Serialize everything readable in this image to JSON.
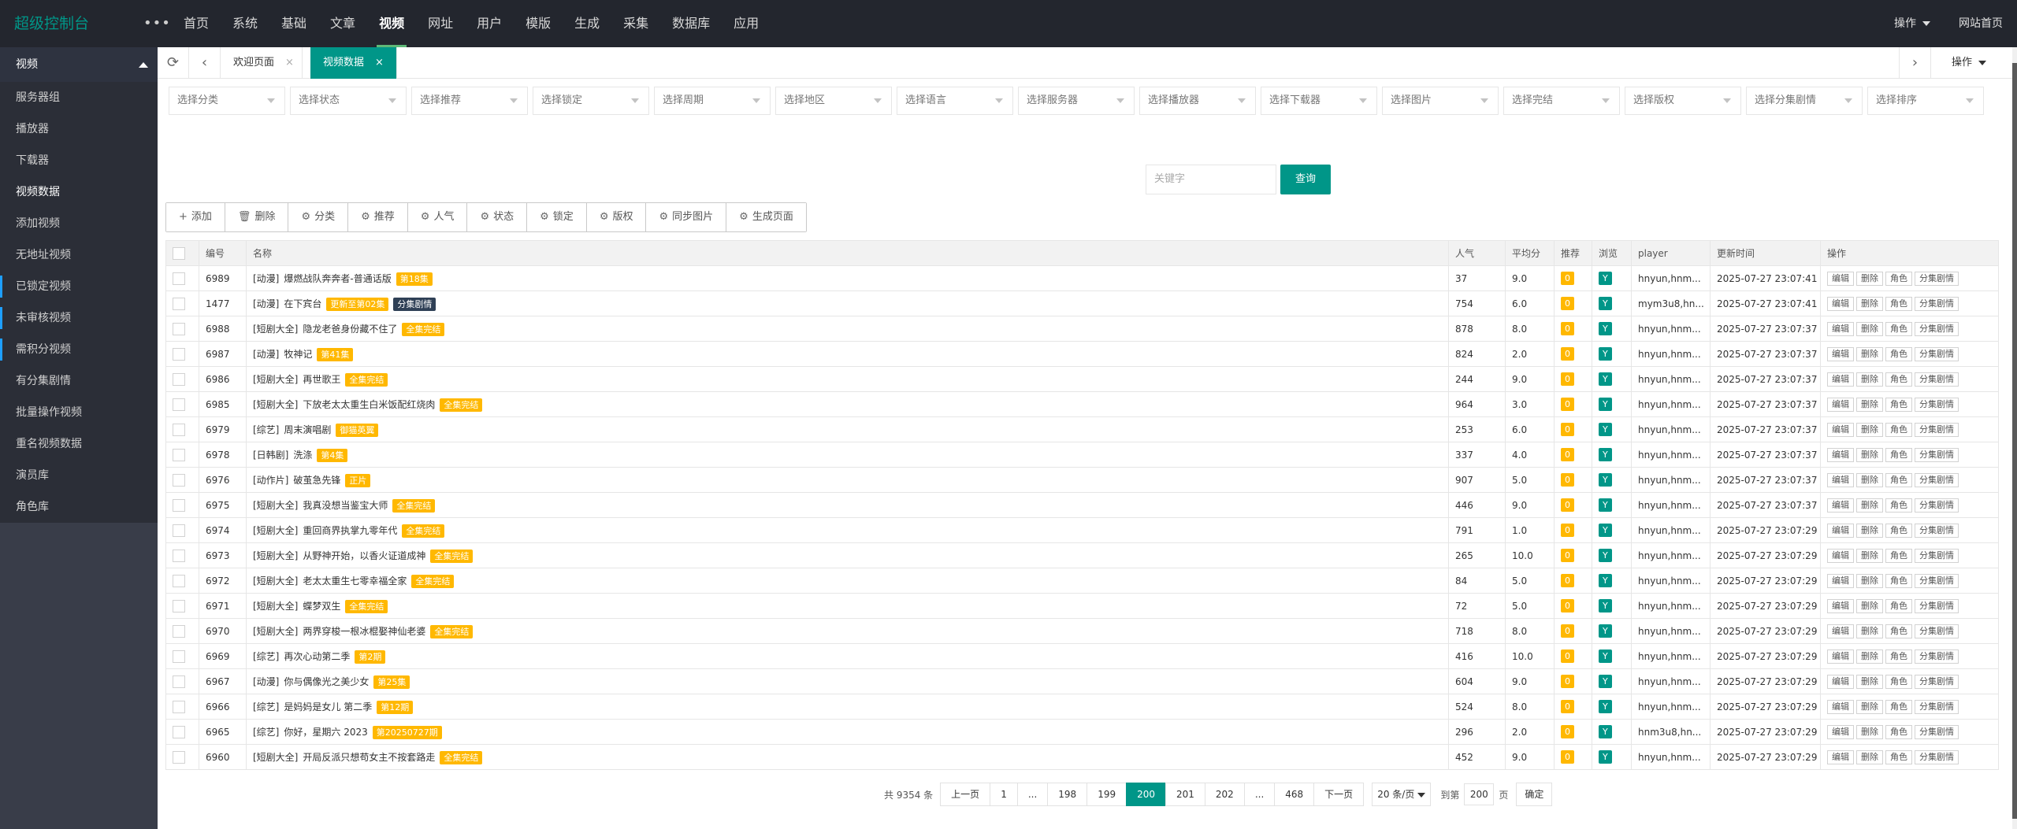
{
  "topbar": {
    "logo": "超级控制台",
    "more": "•••",
    "nav": [
      "首页",
      "系统",
      "基础",
      "文章",
      "视频",
      "网址",
      "用户",
      "模版",
      "生成",
      "采集",
      "数据库",
      "应用"
    ],
    "active": "视频",
    "right": {
      "ops": "操作",
      "site": "网站首页"
    }
  },
  "sidebar": {
    "title": "视频",
    "items": [
      "服务器组",
      "播放器",
      "下载器",
      "视频数据",
      "添加视频",
      "无地址视频",
      "已锁定视频",
      "未审核视频",
      "需积分视频",
      "有分集剧情",
      "批量操作视频",
      "重名视频数据",
      "演员库",
      "角色库"
    ],
    "active": "视频数据"
  },
  "tabs": {
    "welcome": "欢迎页面",
    "current": "视频数据",
    "ops": "操作",
    "close": "×"
  },
  "filters": [
    "选择分类",
    "选择状态",
    "选择推荐",
    "选择锁定",
    "选择周期",
    "选择地区",
    "选择语言",
    "选择服务器",
    "选择播放器",
    "选择下载器",
    "选择图片",
    "选择完结",
    "选择版权",
    "选择分集剧情",
    "选择排序"
  ],
  "search": {
    "placeholder": "关键字",
    "button": "查询"
  },
  "toolbar": [
    {
      "icon": "+",
      "label": "添加"
    },
    {
      "icon": "🗑",
      "label": "删除"
    },
    {
      "icon": "⚙",
      "label": "分类"
    },
    {
      "icon": "⚙",
      "label": "推荐"
    },
    {
      "icon": "⚙",
      "label": "人气"
    },
    {
      "icon": "⚙",
      "label": "状态"
    },
    {
      "icon": "⚙",
      "label": "锁定"
    },
    {
      "icon": "⚙",
      "label": "版权"
    },
    {
      "icon": "⚙",
      "label": "同步图片"
    },
    {
      "icon": "⚙",
      "label": "生成页面"
    }
  ],
  "table": {
    "headers": {
      "id": "编号",
      "name": "名称",
      "hits": "人气",
      "score": "平均分",
      "rec": "推荐",
      "browse": "浏览",
      "player": "player",
      "time": "更新时间",
      "ops": "操作"
    },
    "ops": [
      "编辑",
      "删除",
      "角色",
      "分集剧情"
    ],
    "rows": [
      {
        "id": "6989",
        "cat": "[动漫]",
        "name": "爆燃战队奔奔者-普通话版",
        "tag": "第18集",
        "tag2": "",
        "hits": "37",
        "score": "9.0",
        "rec": "0",
        "browse": "Y",
        "player": "hnyun,hnm...",
        "time": "2025-07-27 23:07:41"
      },
      {
        "id": "1477",
        "cat": "[动漫]",
        "name": "在下宾台",
        "tag": "更新至第02集",
        "tag2": "分集剧情",
        "hits": "754",
        "score": "6.0",
        "rec": "0",
        "browse": "Y",
        "player": "mym3u8,hn...",
        "time": "2025-07-27 23:07:41"
      },
      {
        "id": "6988",
        "cat": "[短剧大全]",
        "name": "隐龙老爸身份藏不住了",
        "tag": "全集完结",
        "tag2": "",
        "hits": "878",
        "score": "8.0",
        "rec": "0",
        "browse": "Y",
        "player": "hnyun,hnm...",
        "time": "2025-07-27 23:07:37"
      },
      {
        "id": "6987",
        "cat": "[动漫]",
        "name": "牧神记",
        "tag": "第41集",
        "tag2": "",
        "hits": "824",
        "score": "2.0",
        "rec": "0",
        "browse": "Y",
        "player": "hnyun,hnm...",
        "time": "2025-07-27 23:07:37"
      },
      {
        "id": "6986",
        "cat": "[短剧大全]",
        "name": "再世歌王",
        "tag": "全集完结",
        "tag2": "",
        "hits": "244",
        "score": "9.0",
        "rec": "0",
        "browse": "Y",
        "player": "hnyun,hnm...",
        "time": "2025-07-27 23:07:37"
      },
      {
        "id": "6985",
        "cat": "[短剧大全]",
        "name": "下放老太太重生白米饭配红烧肉",
        "tag": "全集完结",
        "tag2": "",
        "hits": "964",
        "score": "3.0",
        "rec": "0",
        "browse": "Y",
        "player": "hnyun,hnm...",
        "time": "2025-07-27 23:07:37"
      },
      {
        "id": "6979",
        "cat": "[综艺]",
        "name": "周末演唱剧",
        "tag": "御猫英翼",
        "tag2": "",
        "hits": "253",
        "score": "6.0",
        "rec": "0",
        "browse": "Y",
        "player": "hnyun,hnm...",
        "time": "2025-07-27 23:07:37"
      },
      {
        "id": "6978",
        "cat": "[日韩剧]",
        "name": "洗涤",
        "tag": "第4集",
        "tag2": "",
        "hits": "337",
        "score": "4.0",
        "rec": "0",
        "browse": "Y",
        "player": "hnyun,hnm...",
        "time": "2025-07-27 23:07:37"
      },
      {
        "id": "6976",
        "cat": "[动作片]",
        "name": "破茧急先锋",
        "tag": "正片",
        "tag2": "",
        "hits": "907",
        "score": "5.0",
        "rec": "0",
        "browse": "Y",
        "player": "hnyun,hnm...",
        "time": "2025-07-27 23:07:37"
      },
      {
        "id": "6975",
        "cat": "[短剧大全]",
        "name": "我真没想当鉴宝大师",
        "tag": "全集完结",
        "tag2": "",
        "hits": "446",
        "score": "9.0",
        "rec": "0",
        "browse": "Y",
        "player": "hnyun,hnm...",
        "time": "2025-07-27 23:07:37"
      },
      {
        "id": "6974",
        "cat": "[短剧大全]",
        "name": "重回商界执掌九零年代",
        "tag": "全集完结",
        "tag2": "",
        "hits": "791",
        "score": "1.0",
        "rec": "0",
        "browse": "Y",
        "player": "hnyun,hnm...",
        "time": "2025-07-27 23:07:29"
      },
      {
        "id": "6973",
        "cat": "[短剧大全]",
        "name": "从野神开始，以香火证道成神",
        "tag": "全集完结",
        "tag2": "",
        "hits": "265",
        "score": "10.0",
        "rec": "0",
        "browse": "Y",
        "player": "hnyun,hnm...",
        "time": "2025-07-27 23:07:29"
      },
      {
        "id": "6972",
        "cat": "[短剧大全]",
        "name": "老太太重生七零幸福全家",
        "tag": "全集完结",
        "tag2": "",
        "hits": "84",
        "score": "5.0",
        "rec": "0",
        "browse": "Y",
        "player": "hnyun,hnm...",
        "time": "2025-07-27 23:07:29"
      },
      {
        "id": "6971",
        "cat": "[短剧大全]",
        "name": "蝶梦双生",
        "tag": "全集完结",
        "tag2": "",
        "hits": "72",
        "score": "5.0",
        "rec": "0",
        "browse": "Y",
        "player": "hnyun,hnm...",
        "time": "2025-07-27 23:07:29"
      },
      {
        "id": "6970",
        "cat": "[短剧大全]",
        "name": "两界穿梭一根冰棍娶神仙老婆",
        "tag": "全集完结",
        "tag2": "",
        "hits": "718",
        "score": "8.0",
        "rec": "0",
        "browse": "Y",
        "player": "hnyun,hnm...",
        "time": "2025-07-27 23:07:29"
      },
      {
        "id": "6969",
        "cat": "[综艺]",
        "name": "再次心动第二季",
        "tag": "第2期",
        "tag2": "",
        "hits": "416",
        "score": "10.0",
        "rec": "0",
        "browse": "Y",
        "player": "hnyun,hnm...",
        "time": "2025-07-27 23:07:29"
      },
      {
        "id": "6967",
        "cat": "[动漫]",
        "name": "你与偶像光之美少女",
        "tag": "第25集",
        "tag2": "",
        "hits": "604",
        "score": "9.0",
        "rec": "0",
        "browse": "Y",
        "player": "hnyun,hnm...",
        "time": "2025-07-27 23:07:29"
      },
      {
        "id": "6966",
        "cat": "[综艺]",
        "name": "是妈妈是女儿 第二季",
        "tag": "第12期",
        "tag2": "",
        "hits": "524",
        "score": "8.0",
        "rec": "0",
        "browse": "Y",
        "player": "hnyun,hnm...",
        "time": "2025-07-27 23:07:29"
      },
      {
        "id": "6965",
        "cat": "[综艺]",
        "name": "你好，星期六 2023",
        "tag": "第20250727期",
        "tag2": "",
        "hits": "296",
        "score": "2.0",
        "rec": "0",
        "browse": "Y",
        "player": "hnm3u8,hn...",
        "time": "2025-07-27 23:07:29"
      },
      {
        "id": "6960",
        "cat": "[短剧大全]",
        "name": "开局反派只想苟女主不按套路走",
        "tag": "全集完结",
        "tag2": "",
        "hits": "452",
        "score": "9.0",
        "rec": "0",
        "browse": "Y",
        "player": "hnyun,hnm...",
        "time": "2025-07-27 23:07:29"
      }
    ]
  },
  "pager": {
    "total": "共 9354 条",
    "prev": "上一页",
    "pages": [
      "1",
      "...",
      "198",
      "199",
      "200",
      "201",
      "202",
      "...",
      "468"
    ],
    "current": "200",
    "next": "下一页",
    "size": "20 条/页",
    "goto_label": "到第",
    "goto_value": "200",
    "page_unit": "页",
    "confirm": "确定"
  },
  "colors": {
    "accent": "#009688",
    "topbar": "#23262e",
    "sidebar": "#393d49",
    "tag": "#ffb800"
  }
}
